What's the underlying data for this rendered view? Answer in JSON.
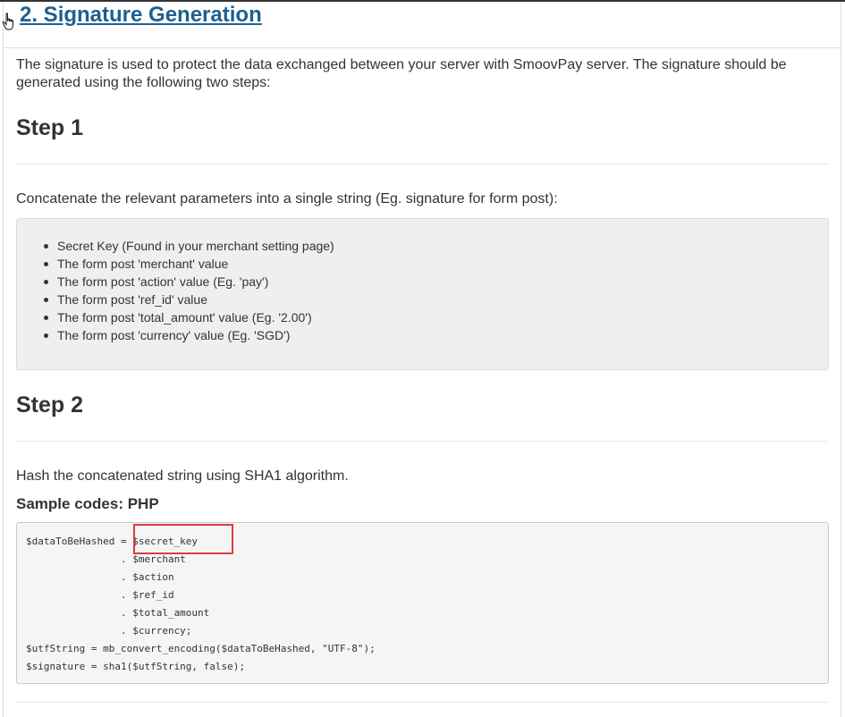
{
  "section": {
    "title": "2. Signature Generation"
  },
  "intro": "The signature is used to protect the data exchanged between your server with SmoovPay server. The signature should be generated using the following two steps:",
  "step1": {
    "heading": "Step 1",
    "description": "Concatenate the relevant parameters into a single string (Eg. signature for form post):",
    "items": [
      "Secret Key (Found in your merchant setting page)",
      "The form post 'merchant' value",
      "The form post 'action' value (Eg. 'pay')",
      "The form post 'ref_id' value",
      "The form post 'total_amount' value (Eg. '2.00')",
      "The form post 'currency' value (Eg. 'SGD')"
    ]
  },
  "step2": {
    "heading": "Step 2",
    "description": "Hash the concatenated string using SHA1 algorithm.",
    "sample_label": "Sample codes: PHP",
    "code_lines": [
      "$dataToBeHashed = $secret_key",
      "                . $merchant",
      "                . $action",
      "                . $ref_id",
      "                . $total_amount",
      "                . $currency;",
      "$utfString = mb_convert_encoding($dataToBeHashed, \"UTF-8\");",
      "$signature = sha1($utfString, false);"
    ]
  },
  "colors": {
    "title_link": "#1e5f8e",
    "highlight": "#e03b3b",
    "well_bg": "#efefef",
    "code_bg": "#f5f5f5"
  },
  "icons": {
    "cursor": "hand-pointer-icon"
  }
}
